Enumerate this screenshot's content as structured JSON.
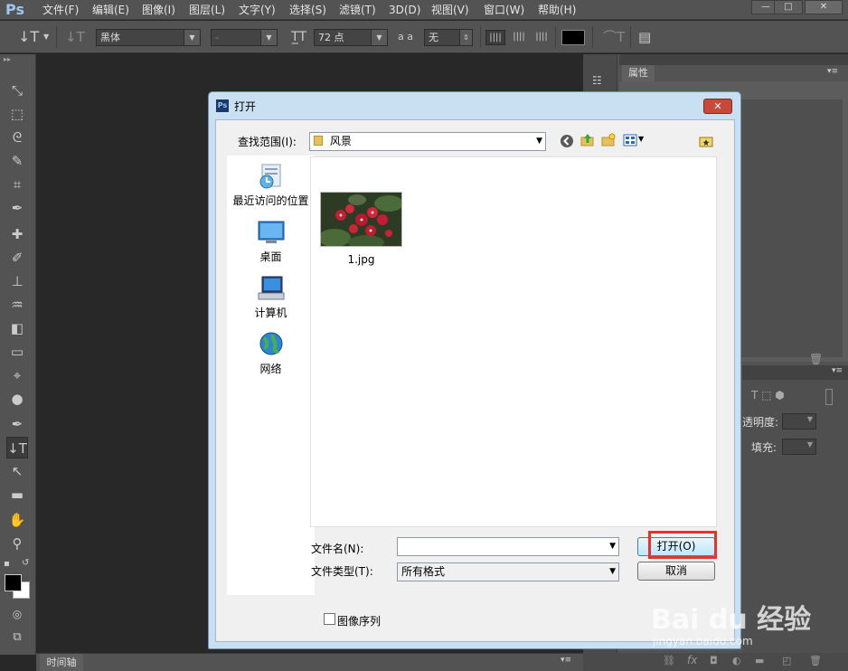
{
  "app": {
    "logo": "Ps"
  },
  "menu": [
    "文件(F)",
    "编辑(E)",
    "图像(I)",
    "图层(L)",
    "文字(Y)",
    "选择(S)",
    "滤镜(T)",
    "3D(D)",
    "视图(V)",
    "窗口(W)",
    "帮助(H)"
  ],
  "window_buttons": {
    "minimize": "—",
    "restore": "□",
    "close": "✕"
  },
  "options_bar": {
    "font_family": "黑体",
    "font_style": "-",
    "font_size": "72 点",
    "antialias_icon_text": "a a",
    "antialias": "无",
    "color": "#000000"
  },
  "panels": {
    "properties_tab": "属性",
    "opacity_label": "透明度:",
    "fill_label": "填充:"
  },
  "timeline_tab": "时间轴",
  "dialog": {
    "title": "打开",
    "look_in_label": "查找范围(I):",
    "look_in_value": "风景",
    "places": [
      "最近访问的位置",
      "桌面",
      "计算机",
      "网络"
    ],
    "files": [
      {
        "name": "1.jpg"
      }
    ],
    "filename_label": "文件名(N):",
    "filename_value": "",
    "filetype_label": "文件类型(T):",
    "filetype_value": "所有格式",
    "open_button": "打开(O)",
    "cancel_button": "取消",
    "image_sequence_label": "图像序列",
    "image_sequence_checked": false
  },
  "watermark": {
    "brand": "Bai du 经验",
    "url": "jingyan.baidu.com"
  }
}
